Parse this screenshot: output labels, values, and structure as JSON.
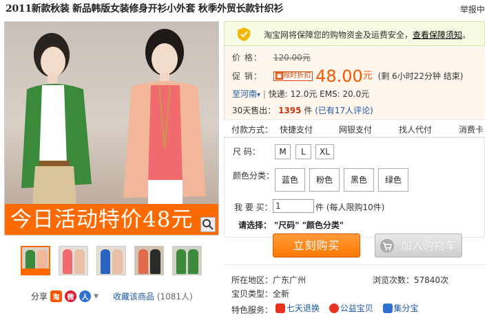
{
  "header": {
    "title": "2011新款秋装 新品韩版女装修身开衫小外套 秋季外贸长款针织衫",
    "report_link": "举报中"
  },
  "gallery": {
    "promo_text": "今日活动特价48元",
    "thumbnail_count": 5
  },
  "share": {
    "label": "分享",
    "favorite_label": "收藏该商品",
    "favorite_count": "(1081人)"
  },
  "guarantee": {
    "text": "淘宝网将保障您的购物资金及运费安全，",
    "link": "查看保障须知",
    "tail": "。"
  },
  "price": {
    "label": "价      格：",
    "original": "120.00元",
    "promo_label": "促      销：",
    "badge": "限时折扣",
    "promo_price": "48.00",
    "promo_unit": "元",
    "countdown": "(剩 6小时22分钟 结束)"
  },
  "shipping": {
    "region": "至河南",
    "arrow": "▾",
    "text": "快递: 12.0元   EMS: 20.0元"
  },
  "sales": {
    "label": "30天售出：",
    "count": "1395",
    "unit": "件",
    "reviews": "(已有17人评论)"
  },
  "payment": {
    "label": "付款方式：",
    "methods": [
      "快捷支付",
      "网银支付",
      "找人代付",
      "消费卡"
    ]
  },
  "sku": {
    "size_label": "尺      码：",
    "sizes": [
      "M",
      "L",
      "XL"
    ],
    "color_label": "颜色分类：",
    "colors": [
      "蓝色",
      "粉色",
      "黑色",
      "绿色"
    ],
    "qty_label": "我 要 买：",
    "qty_value": "1",
    "qty_note": "件 (每人限购10件)",
    "prompt_label": "请选择：",
    "prompt_text": "\"尺码\" \"颜色分类\"",
    "buy_label": "立刻购买",
    "cart_label": "加入购物车"
  },
  "details": {
    "location_label": "所在地区：",
    "location": "广东广州",
    "views_label": "浏览次数：",
    "views": "57840次",
    "type_label": "宝贝类型：",
    "type": "全新",
    "service_label": "特色服务：",
    "services": [
      "七天退换",
      "公益宝贝",
      "集分宝"
    ]
  },
  "colors": {
    "accent": "#ff5500",
    "buy_button": "#ff7a00",
    "link": "#1a57a7",
    "guarantee_bg": "#f7fbe3",
    "info_bg": "#fff6ee"
  }
}
